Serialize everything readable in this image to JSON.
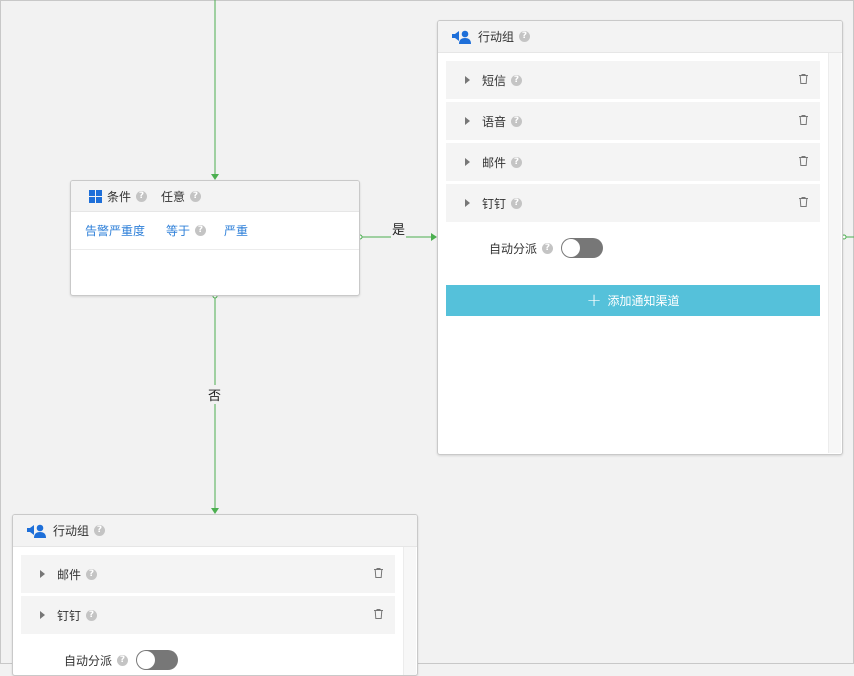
{
  "colors": {
    "edge": "#4caf50",
    "accent_link": "#2f80d9",
    "add_button": "#55c1da",
    "toggle_off": "#777777",
    "brand_blue": "#1e6fd9"
  },
  "edges": {
    "yes_label": "是",
    "no_label": "否"
  },
  "condition": {
    "title": "条件",
    "mode": "任意",
    "field": "告警严重度",
    "operator": "等于",
    "value": "严重"
  },
  "action_group_right": {
    "title": "行动组",
    "channels": [
      {
        "label": "短信"
      },
      {
        "label": "语音"
      },
      {
        "label": "邮件"
      },
      {
        "label": "钉钉"
      }
    ],
    "auto_assign_label": "自动分派",
    "auto_assign_on": false,
    "add_channel_label": "添加通知渠道"
  },
  "action_group_bottom": {
    "title": "行动组",
    "channels": [
      {
        "label": "邮件"
      },
      {
        "label": "钉钉"
      }
    ],
    "auto_assign_label": "自动分派",
    "auto_assign_on": false
  }
}
